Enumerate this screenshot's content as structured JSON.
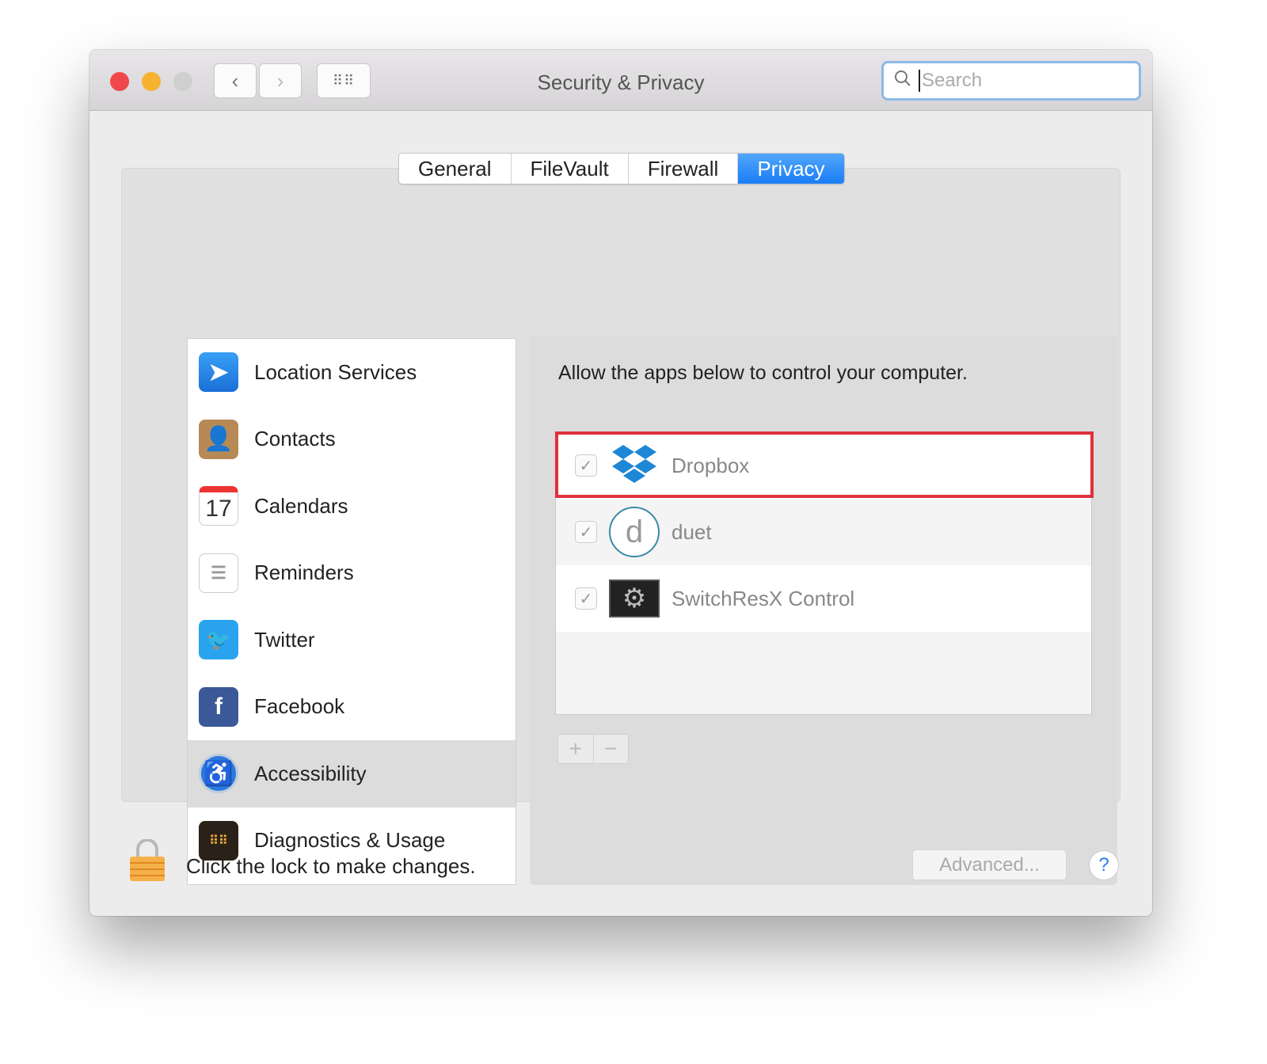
{
  "window": {
    "title": "Security & Privacy",
    "search_placeholder": "Search"
  },
  "tabs": [
    {
      "label": "General"
    },
    {
      "label": "FileVault"
    },
    {
      "label": "Firewall"
    },
    {
      "label": "Privacy",
      "active": true
    }
  ],
  "sidebar": {
    "items": [
      {
        "label": "Location Services",
        "icon": "location-arrow-icon"
      },
      {
        "label": "Contacts",
        "icon": "contacts-book-icon"
      },
      {
        "label": "Calendars",
        "icon": "calendar-icon",
        "icon_text": "17"
      },
      {
        "label": "Reminders",
        "icon": "reminders-list-icon"
      },
      {
        "label": "Twitter",
        "icon": "twitter-bird-icon"
      },
      {
        "label": "Facebook",
        "icon": "facebook-icon"
      },
      {
        "label": "Accessibility",
        "icon": "accessibility-icon",
        "selected": true
      },
      {
        "label": "Diagnostics & Usage",
        "icon": "diagnostics-grid-icon"
      }
    ]
  },
  "main": {
    "description": "Allow the apps below to control your computer.",
    "apps": [
      {
        "name": "Dropbox",
        "checked": true,
        "highlighted": true
      },
      {
        "name": "duet",
        "checked": true
      },
      {
        "name": "SwitchResX Control",
        "checked": true
      }
    ],
    "add_label": "+",
    "remove_label": "−"
  },
  "footer": {
    "lock_message": "Click the lock to make changes.",
    "advanced_label": "Advanced...",
    "help_label": "?"
  },
  "colors": {
    "accent": "#1a7df6",
    "highlight": "#e0303c",
    "close": "#f0484a",
    "minimize": "#f5b331"
  }
}
